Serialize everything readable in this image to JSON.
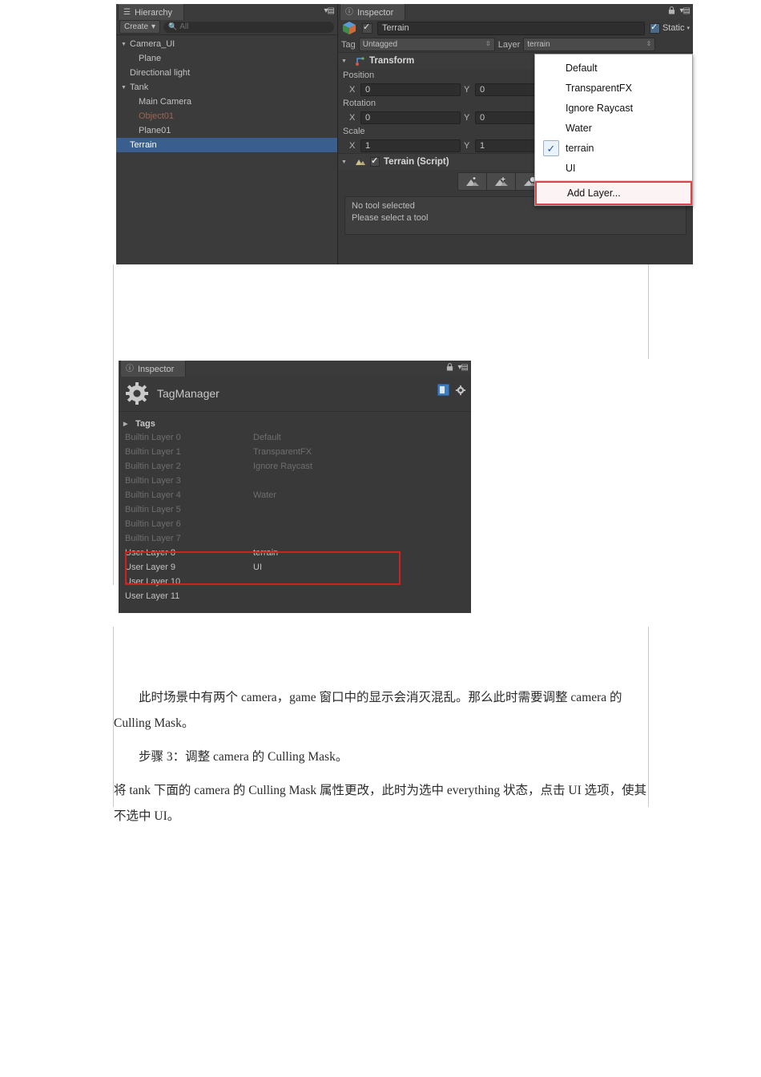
{
  "screenshot1": {
    "hierarchy": {
      "tab_label": "Hierarchy",
      "tab_icon": "hierarchy-icon",
      "create_label": "Create",
      "create_caret": "▾",
      "search_placeholder": "All",
      "search_icon": "search-icon",
      "menu_icon": "panel-menu-icon",
      "items": [
        {
          "label": "Camera_UI",
          "arrow": "▼",
          "indent": 0,
          "selected": false,
          "red": false
        },
        {
          "label": "Plane",
          "arrow": "",
          "indent": 2,
          "selected": false,
          "red": false
        },
        {
          "label": "Directional light",
          "arrow": "",
          "indent": 1,
          "selected": false,
          "red": false
        },
        {
          "label": "Tank",
          "arrow": "▼",
          "indent": 0,
          "selected": false,
          "red": false
        },
        {
          "label": "Main Camera",
          "arrow": "",
          "indent": 2,
          "selected": false,
          "red": false
        },
        {
          "label": "Object01",
          "arrow": "",
          "indent": 2,
          "selected": false,
          "red": true
        },
        {
          "label": "Plane01",
          "arrow": "",
          "indent": 2,
          "selected": false,
          "red": false
        },
        {
          "label": "Terrain",
          "arrow": "",
          "indent": 1,
          "selected": true,
          "red": false
        }
      ]
    },
    "inspector": {
      "tab_label": "Inspector",
      "tab_icon": "info-icon",
      "lock_icon": "lock-icon",
      "menu_icon": "panel-menu-icon",
      "object_name": "Terrain",
      "object_enabled": true,
      "static_label": "Static",
      "static_checked": true,
      "static_caret": "▾",
      "tag_label": "Tag",
      "tag_value": "Untagged",
      "layer_label": "Layer",
      "layer_value": "terrain",
      "transform": {
        "title": "Transform",
        "fold_arrow": "▼",
        "icon": "transform-icon",
        "rows": [
          {
            "name": "Position",
            "x_label": "X",
            "x_value": "0",
            "y_label": "Y",
            "y_value": "0"
          },
          {
            "name": "Rotation",
            "x_label": "X",
            "x_value": "0",
            "y_label": "Y",
            "y_value": "0"
          },
          {
            "name": "Scale",
            "x_label": "X",
            "x_value": "1",
            "y_label": "Y",
            "y_value": "1"
          }
        ]
      },
      "terrain_component": {
        "title": "Terrain (Script)",
        "fold_arrow": "▼",
        "icon": "terrain-icon",
        "enabled": true,
        "tools": [
          "raise-lower-terrain-icon",
          "paint-height-icon",
          "smooth-height-icon",
          "paint-texture-icon"
        ],
        "help_line1": "No tool selected",
        "help_line2": "Please select a tool"
      }
    },
    "layer_dropdown": {
      "items": [
        {
          "label": "Default",
          "checked": false
        },
        {
          "label": "TransparentFX",
          "checked": false
        },
        {
          "label": "Ignore Raycast",
          "checked": false
        },
        {
          "label": "Water",
          "checked": false
        },
        {
          "label": "terrain",
          "checked": true
        },
        {
          "label": "UI",
          "checked": false
        }
      ],
      "check_glyph": "✓",
      "add_layer_label": "Add Layer...",
      "highlight_color": "#cc2222"
    }
  },
  "screenshot2": {
    "tab_label": "Inspector",
    "tab_icon": "info-icon",
    "lock_icon": "lock-icon",
    "menu_icon": "panel-menu-icon",
    "title": "TagManager",
    "title_icon": "gear-icon",
    "preset_icon": "preset-icon",
    "settings_icon": "gear-icon",
    "tags_section_label": "Tags",
    "tags_fold_arrow": "▶",
    "layers": [
      {
        "name": "Builtin Layer 0",
        "value": "Default",
        "builtin": true
      },
      {
        "name": "Builtin Layer 1",
        "value": "TransparentFX",
        "builtin": true
      },
      {
        "name": "Builtin Layer 2",
        "value": "Ignore Raycast",
        "builtin": true
      },
      {
        "name": "Builtin Layer 3",
        "value": "",
        "builtin": true
      },
      {
        "name": "Builtin Layer 4",
        "value": "Water",
        "builtin": true
      },
      {
        "name": "Builtin Layer 5",
        "value": "",
        "builtin": true
      },
      {
        "name": "Builtin Layer 6",
        "value": "",
        "builtin": true
      },
      {
        "name": "Builtin Layer 7",
        "value": "",
        "builtin": true
      },
      {
        "name": "User Layer 8",
        "value": "terrain",
        "builtin": false
      },
      {
        "name": "User Layer 9",
        "value": "UI",
        "builtin": false
      },
      {
        "name": "User Layer 10",
        "value": "",
        "builtin": false
      },
      {
        "name": "User Layer 11",
        "value": "",
        "builtin": false
      }
    ],
    "highlight_color": "#cc2222"
  },
  "document": {
    "para1": "此时场景中有两个 camera，game 窗口中的显示会消灭混乱。那么此时需要调整 camera 的 Culling Mask。",
    "para2": "步骤 3：调整 camera 的 Culling Mask。",
    "para3": "将 tank 下面的 camera 的 Culling Mask 属性更改，此时为选中 everything 状态，点击 UI 选项，使其不选中 UI。"
  }
}
